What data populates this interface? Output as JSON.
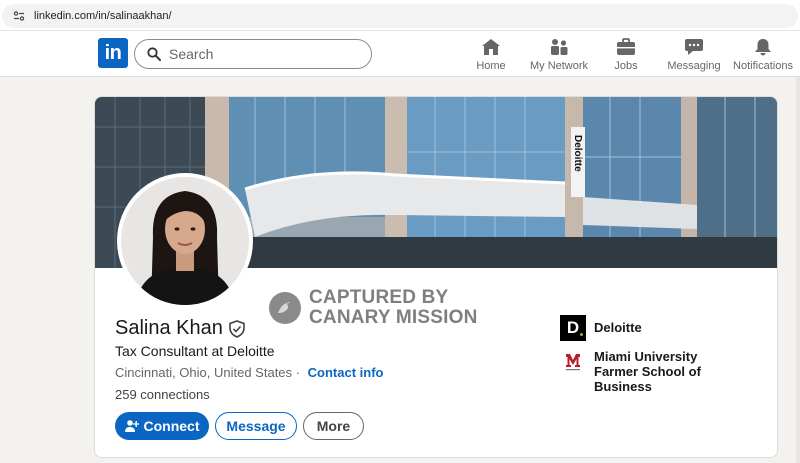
{
  "browser": {
    "url": "linkedin.com/in/salinaakhan/"
  },
  "header": {
    "logo": "in",
    "search_placeholder": "Search",
    "nav": [
      {
        "label": "Home",
        "icon": "home-icon"
      },
      {
        "label": "My Network",
        "icon": "network-icon"
      },
      {
        "label": "Jobs",
        "icon": "jobs-icon"
      },
      {
        "label": "Messaging",
        "icon": "messaging-icon"
      },
      {
        "label": "Notifications",
        "icon": "bell-icon"
      }
    ]
  },
  "profile": {
    "name": "Salina Khan",
    "headline": "Tax Consultant at Deloitte",
    "location": "Cincinnati, Ohio, United States",
    "separator": "·",
    "contact_info": "Contact info",
    "connections": "259 connections",
    "buttons": {
      "connect": "Connect",
      "message": "Message",
      "more": "More"
    },
    "banner_sign": "Deloitte",
    "organizations": [
      {
        "name": "Deloitte",
        "logo": "deloitte-logo"
      },
      {
        "name": "Miami University Farmer School of Business",
        "logo": "miami-logo"
      }
    ]
  },
  "watermark": {
    "line1": "CAPTURED BY",
    "line2": "CANARY MISSION"
  },
  "colors": {
    "brand": "#0a66c2",
    "background": "#f3f2ef",
    "deloitte_green": "#86bc25"
  }
}
